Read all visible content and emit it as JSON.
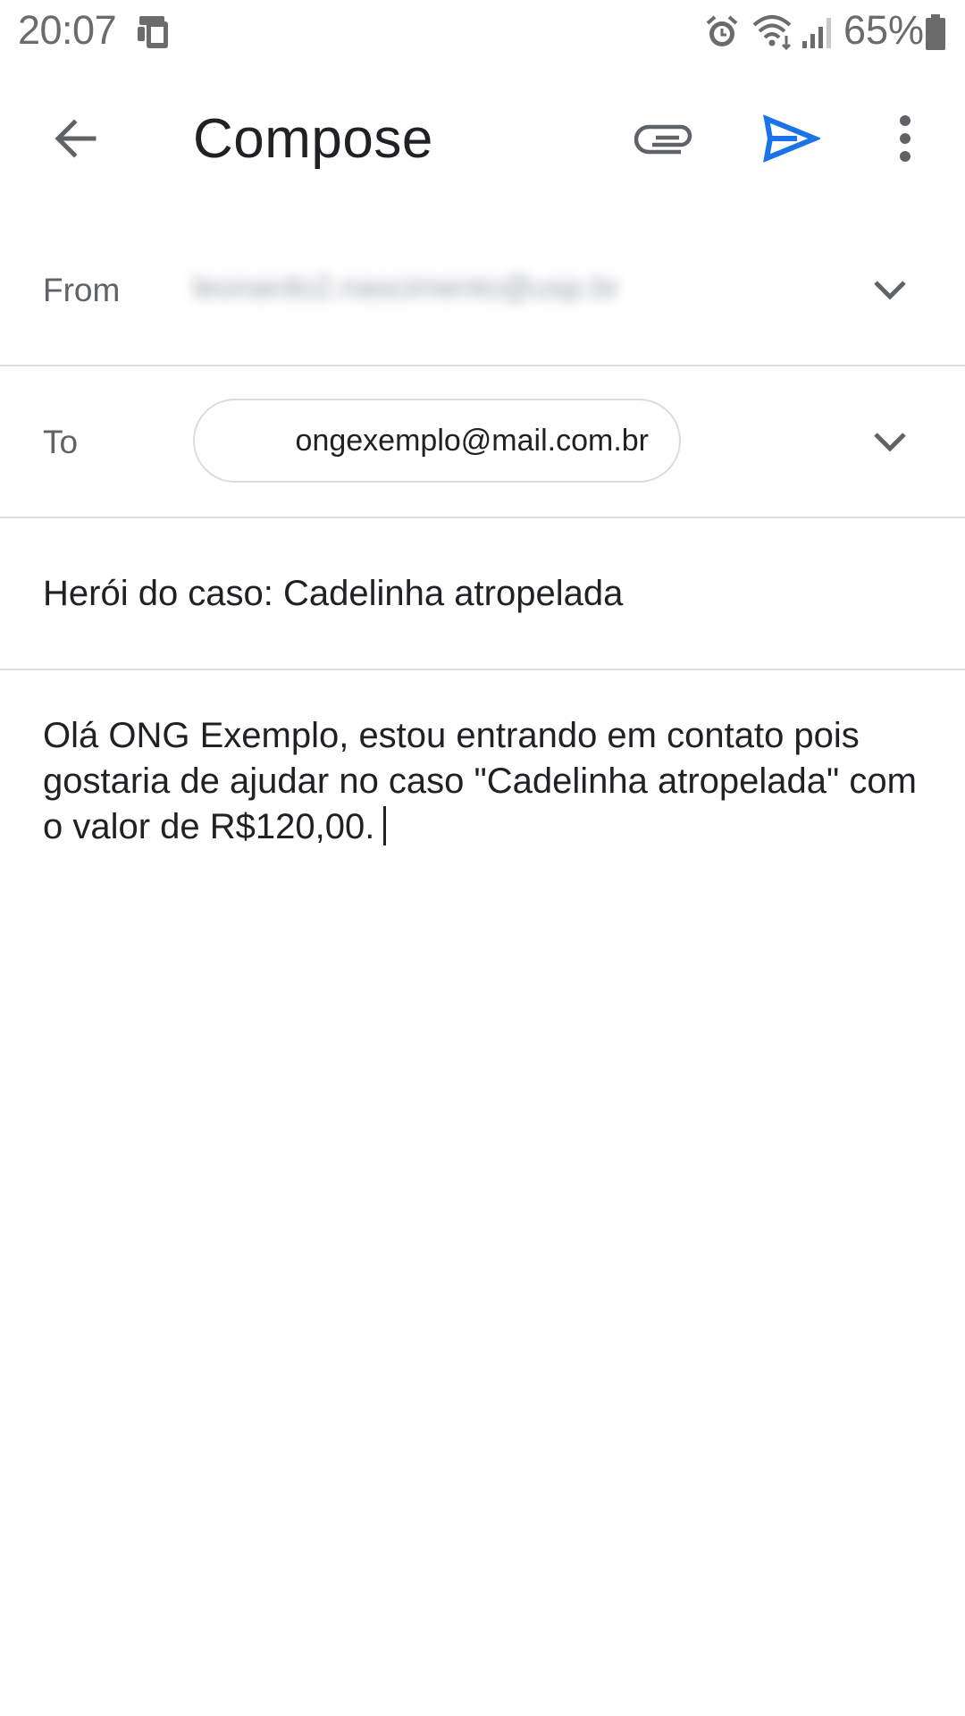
{
  "status_bar": {
    "time": "20:07",
    "battery": "65%",
    "icons": [
      "device-icon",
      "alarm-icon",
      "wifi-icon",
      "signal-icon",
      "battery-icon"
    ]
  },
  "app_bar": {
    "title": "Compose",
    "icons": {
      "back": "back-arrow-icon",
      "attach": "paperclip-icon",
      "send": "send-icon",
      "more": "more-vert-icon"
    },
    "send_color": "#1a73e8"
  },
  "form": {
    "from_label": "From",
    "from_value": "leonardo2.nascimento@usp.br",
    "to_label": "To",
    "to_chip": "ongexemplo@mail.com.br",
    "subject": "Herói do caso: Cadelinha atropelada",
    "body": "Olá ONG Exemplo, estou entrando em contato pois gostaria de ajudar no caso \"Cadelinha atropelada\" com o valor de R$120,00."
  }
}
